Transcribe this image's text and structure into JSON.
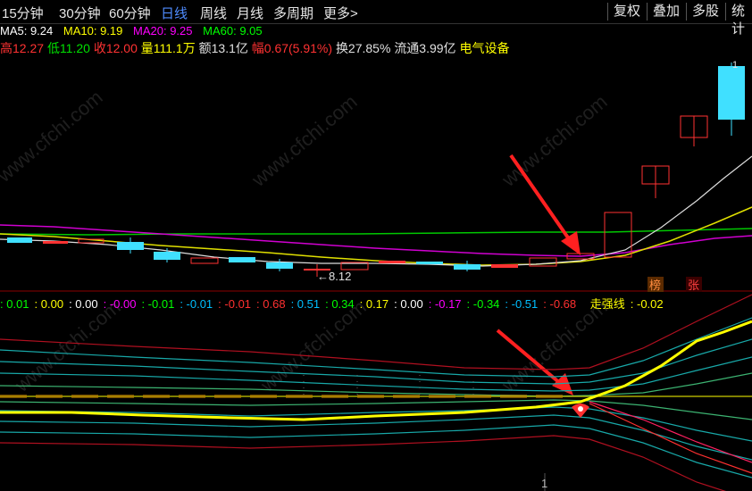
{
  "toolbar": {
    "periods": [
      "15分钟",
      "30分钟",
      "60分钟",
      "日线",
      "周线",
      "月线",
      "多周期",
      "更多"
    ],
    "active_period": "日线",
    "more_arrow": ">",
    "buttons": [
      "复权",
      "叠加",
      "多股",
      "统计"
    ]
  },
  "ma": {
    "ma5": "MA5: 9.24",
    "ma10": "MA10: 9.19",
    "ma20": "MA20: 9.25",
    "ma60": "MA60: 9.05",
    "colors": {
      "ma5": "#ffffff",
      "ma10": "#ffff00",
      "ma20": "#ff00ff",
      "ma60": "#00ff00"
    }
  },
  "quote": {
    "high": "高12.27",
    "low": "低11.20",
    "close": "收12.00",
    "volume": "量111.1万",
    "amount": "额13.1亿",
    "change_label": "幅",
    "change": "0.67(5.91%)",
    "turnover": "换27.85%",
    "float": "流通3.99亿",
    "sector": "电气设备"
  },
  "price_annotation": "←8.12",
  "top_price_label": "1",
  "badges": {
    "bang": "榜",
    "zhang": "张"
  },
  "indicator": {
    "values": [
      ": 0.01",
      ": 0.00",
      ": 0.00",
      ": -0.00",
      ": -0.01",
      ": -0.01",
      ": -0.01",
      ": 0.68",
      ": 0.51",
      ": 0.34",
      ": 0.17",
      ": 0.00",
      ": -0.17",
      ": -0.34",
      ": -0.51",
      ": -0.68"
    ],
    "value_colors": [
      "#00ff00",
      "#ffff00",
      "#ffffff",
      "#ff00ff",
      "#00ff00",
      "#00bfff",
      "#ff3030",
      "#ff3030",
      "#00bfff",
      "#00ff00",
      "#ffff00",
      "#ffffff",
      "#ff00ff",
      "#00ff00",
      "#00bfff",
      "#ff3030"
    ],
    "main_label": "走强线",
    "main_value": ": -0.02"
  },
  "bottom_label": "1",
  "watermark": "www.cfchi.com",
  "colors": {
    "up": "#ff3232",
    "down": "#00ffff",
    "accent": "#4f8cff"
  }
}
